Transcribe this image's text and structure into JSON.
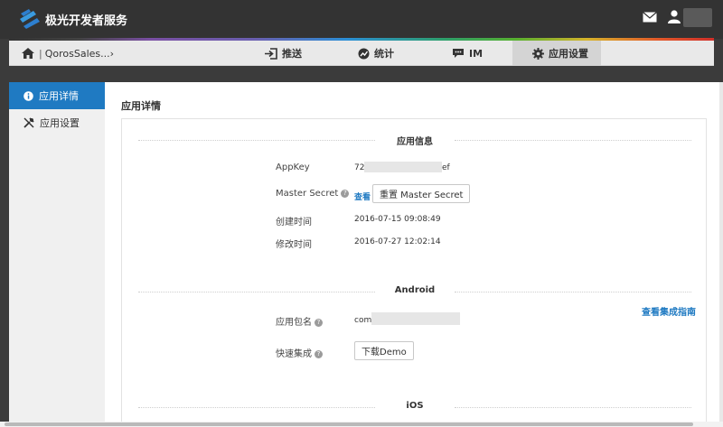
{
  "header": {
    "brand": "极光开发者服务",
    "logo_icon": "jpush-logo-icon",
    "mail_icon": "mail-icon",
    "user_icon": "user-icon"
  },
  "breadcrumb": {
    "home_icon": "home-icon",
    "separator": "|",
    "app_name": "QorosSales...",
    "chevron": "›"
  },
  "nav": {
    "tabs": [
      {
        "label": "推送",
        "icon": "push-icon"
      },
      {
        "label": "统计",
        "icon": "stats-icon"
      },
      {
        "label": "IM",
        "icon": "chat-icon"
      },
      {
        "label": "应用设置",
        "icon": "gear-icon",
        "active": true
      }
    ]
  },
  "sidebar": {
    "items": [
      {
        "label": "应用详情",
        "icon": "info-icon",
        "active": true
      },
      {
        "label": "应用设置",
        "icon": "tools-icon",
        "active": false
      }
    ]
  },
  "main": {
    "title": "应用详情",
    "app_info": {
      "section_title": "应用信息",
      "appkey_label": "AppKey",
      "appkey_prefix": "72",
      "appkey_suffix": "ef",
      "master_secret_label": "Master Secret",
      "view_link": "查看",
      "reset_button": "重置 Master Secret",
      "created_label": "创建时间",
      "created_value": "2016-07-15 09:08:49",
      "modified_label": "修改时间",
      "modified_value": "2016-07-27 12:02:14"
    },
    "android": {
      "section_title": "Android",
      "package_label": "应用包名",
      "package_prefix": "com.",
      "guide_link": "查看集成指南",
      "quick_label": "快速集成",
      "download_button": "下载Demo"
    },
    "ios": {
      "section_title": "iOS"
    }
  },
  "colors": {
    "accent": "#1f7ac2",
    "topbar": "#333333"
  }
}
